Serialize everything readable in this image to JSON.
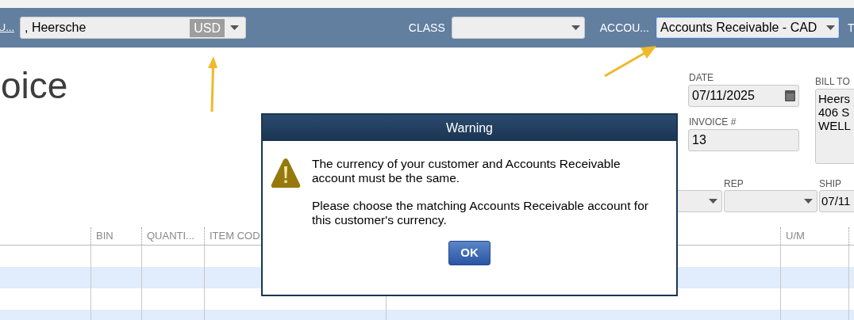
{
  "top_bar": {
    "customer_label": "U...",
    "customer": {
      "value": ", Heersche",
      "currency": "USD"
    },
    "class": {
      "label": "CLASS"
    },
    "account": {
      "label": "ACCOU...",
      "value": "Accounts Receivable - CAD",
      "focused": true
    },
    "next_label": "T"
  },
  "form": {
    "title": "oice",
    "date": {
      "label": "DATE",
      "value": "07/11/2025"
    },
    "invoice_number": {
      "label": "INVOICE #",
      "value": "13"
    },
    "bill_to": {
      "label": "BILL TO",
      "lines": [
        "Heers",
        "406 S",
        "WELL"
      ]
    },
    "rep": {
      "label": "REP"
    },
    "ship": {
      "label": "SHIP",
      "value": "07/11"
    }
  },
  "table": {
    "columns": [
      "",
      "BIN",
      "QUANTI...",
      "ITEM COD",
      "",
      "U/M",
      ""
    ]
  },
  "dialog": {
    "title": "Warning",
    "paragraphs": [
      "The currency of your customer and Accounts Receivable account must be the same.",
      "Please choose the matching Accounts Receivable account for this customer's currency."
    ],
    "button": "OK"
  }
}
